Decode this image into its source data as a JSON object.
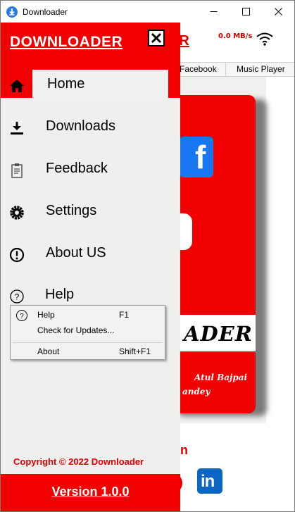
{
  "window": {
    "title": "Downloader"
  },
  "main": {
    "header_title": "ER",
    "speed": "0.0 MB/s",
    "tabs": [
      {
        "label": "Facebook"
      },
      {
        "label": "Music Player"
      }
    ],
    "banner_text": "ADER",
    "author_1": "Atul Bajpai",
    "author_2": "andey",
    "partial_letter": "n"
  },
  "drawer": {
    "title": "DOWNLOADER",
    "items": [
      {
        "label": "Home",
        "icon": "home-icon"
      },
      {
        "label": "Downloads",
        "icon": "download-icon"
      },
      {
        "label": "Feedback",
        "icon": "clipboard-icon"
      },
      {
        "label": "Settings",
        "icon": "gear-icon"
      },
      {
        "label": "About US",
        "icon": "info-icon"
      },
      {
        "label": "Help",
        "icon": "help-icon"
      }
    ],
    "copyright": "Copyright © 2022 Downloader",
    "version": "Version 1.0.0"
  },
  "help_menu": {
    "items": [
      {
        "label": "Help",
        "shortcut": "F1"
      },
      {
        "label": "Check for Updates...",
        "shortcut": ""
      },
      {
        "label": "About",
        "shortcut": "Shift+F1"
      }
    ]
  },
  "colors": {
    "accent_red": "#f20000",
    "drawer_bg": "#efefed",
    "facebook_blue": "#1877f2",
    "linkedin_blue": "#0a66c2"
  }
}
